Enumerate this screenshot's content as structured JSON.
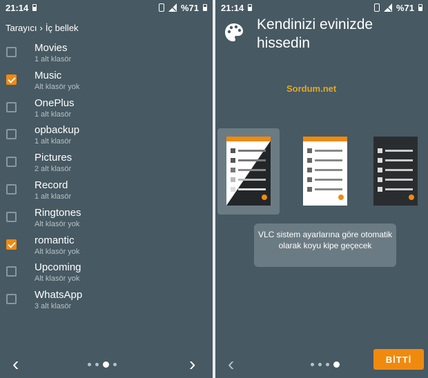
{
  "status": {
    "time": "21:14",
    "battery": "%71"
  },
  "left": {
    "breadcrumb": {
      "root": "Tarayıcı",
      "separator": "›",
      "current": "İç bellek"
    },
    "folders": [
      {
        "name": "Movies",
        "sub": "1 alt klasör",
        "checked": false
      },
      {
        "name": "Music",
        "sub": "Alt klasör yok",
        "checked": true
      },
      {
        "name": "OnePlus",
        "sub": "1 alt klasör",
        "checked": false
      },
      {
        "name": "opbackup",
        "sub": "1 alt klasör",
        "checked": false
      },
      {
        "name": "Pictures",
        "sub": "2 alt klasör",
        "checked": false
      },
      {
        "name": "Record",
        "sub": "1 alt klasör",
        "checked": false
      },
      {
        "name": "Ringtones",
        "sub": "Alt klasör yok",
        "checked": false
      },
      {
        "name": "romantic",
        "sub": "Alt klasör yok",
        "checked": true
      },
      {
        "name": "Upcoming",
        "sub": "Alt klasör yok",
        "checked": false
      },
      {
        "name": "WhatsApp",
        "sub": "3 alt klasör",
        "checked": false
      }
    ],
    "nav": {
      "prev": "‹",
      "next": "›",
      "page_count": 4,
      "active_page": 3
    }
  },
  "right": {
    "title": "Kendinizi evinizde hissedin",
    "watermark": "Sordum.net",
    "themes": [
      {
        "name": "auto",
        "selected": true
      },
      {
        "name": "light",
        "selected": false
      },
      {
        "name": "dark",
        "selected": false
      }
    ],
    "tooltip": "VLC sistem ayarlarına göre otomatik olarak koyu kipe geçecek",
    "nav": {
      "prev": "‹",
      "page_count": 4,
      "active_page": 4,
      "done_label": "BİTTİ"
    }
  },
  "colors": {
    "accent": "#f08a0f",
    "background": "#475962"
  }
}
